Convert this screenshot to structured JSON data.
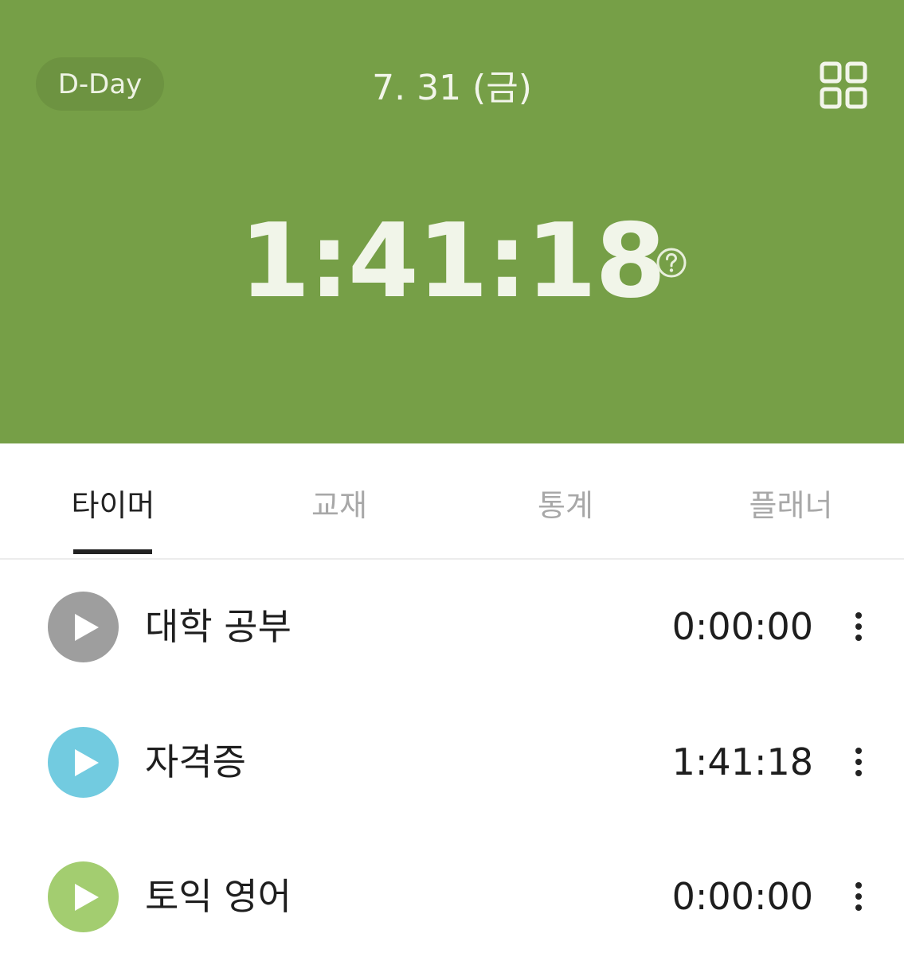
{
  "header": {
    "dday_label": "D-Day",
    "date": "7. 31 (금)",
    "total_time": "1:41:18",
    "bg_color": "#769f47",
    "icons": [
      "grid-icon",
      "help-icon"
    ]
  },
  "tabs": [
    {
      "label": "타이머",
      "active": true
    },
    {
      "label": "교재",
      "active": false
    },
    {
      "label": "통계",
      "active": false
    },
    {
      "label": "플래너",
      "active": false
    }
  ],
  "subjects": [
    {
      "name": "대학 공부",
      "time": "0:00:00",
      "color": "#9e9e9e"
    },
    {
      "name": "자격증",
      "time": "1:41:18",
      "color": "#72cbe0"
    },
    {
      "name": "토익 영어",
      "time": "0:00:00",
      "color": "#a3cd70"
    }
  ]
}
